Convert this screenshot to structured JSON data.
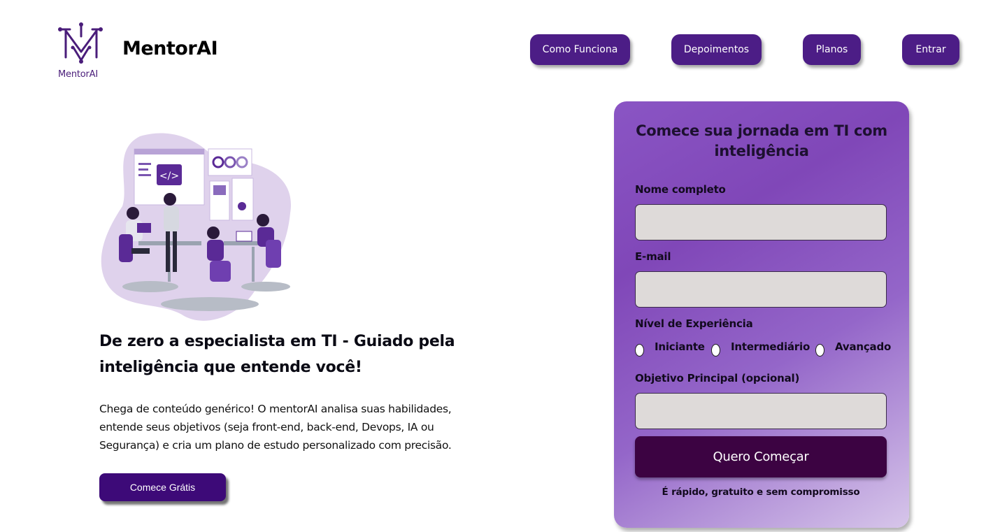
{
  "header": {
    "logo_text": "MentorAI",
    "brand": "MentorAI",
    "nav": [
      {
        "label": "Como Funciona"
      },
      {
        "label": "Depoimentos"
      },
      {
        "label": "Planos"
      },
      {
        "label": "Entrar"
      }
    ]
  },
  "hero": {
    "title": "De zero a especialista em TI - Guiado pela inteligência que entende você!",
    "description": "Chega de conteúdo genérico! O mentorAI analisa suas habilidades, entende seus objetivos (seja front-end, back-end, Devops, IA ou Segurança) e cria um plano de estudo personalizado com precisão.",
    "cta_label": "Comece Grátis",
    "illustration_icon": "team-working-at-desks-illustration"
  },
  "signup": {
    "title": "Comece sua jornada em TI com inteligência",
    "fields": [
      {
        "label": "Nome completo",
        "value": "",
        "placeholder": ""
      },
      {
        "label": "E-mail",
        "value": "",
        "placeholder": ""
      },
      {
        "label": "Objetivo Principal (opcional)",
        "value": "",
        "placeholder": ""
      }
    ],
    "experience_label": "Nível de Experiência",
    "experience_options": [
      "Iniciante",
      "Intermediário",
      "Avançado"
    ],
    "submit_label": "Quero Começar",
    "note": "É rápido, gratuito e sem compromisso"
  },
  "colors": {
    "primary": "#4c1d86",
    "cta": "#3d0a78",
    "submit": "#3c0342",
    "card_gradient_start": "#8a55c4",
    "card_gradient_end": "#d7c6ea",
    "input_bg": "#dedad9"
  }
}
